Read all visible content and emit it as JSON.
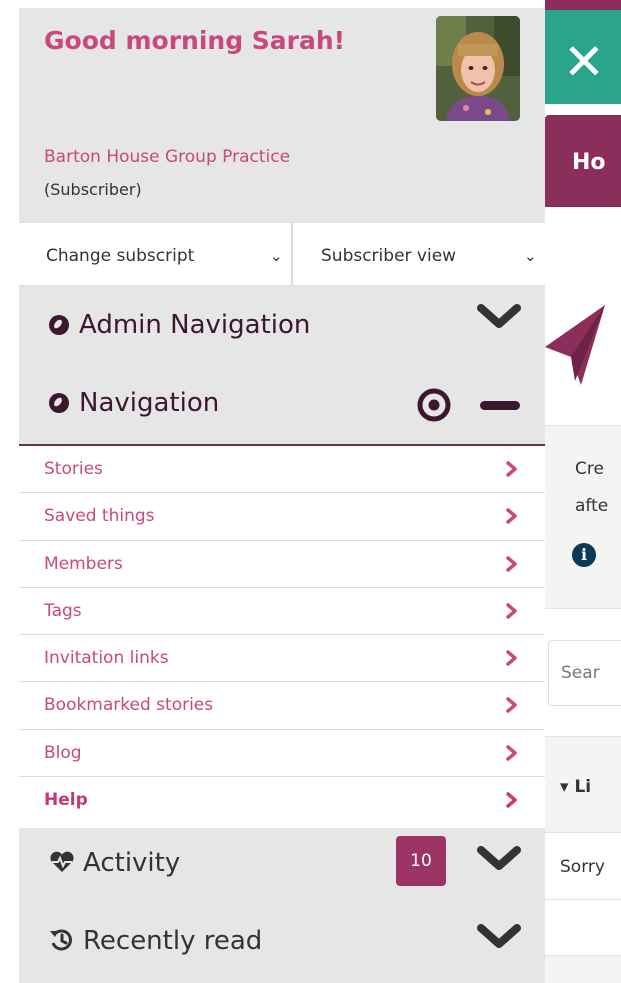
{
  "background": {
    "close_glyph": "✕",
    "home_tab_label": "Ho",
    "panel_line1": "Cre",
    "panel_line2": "afte",
    "info_glyph": "i",
    "search_placeholder": "Sear",
    "list_label": "▾ Li",
    "sorry_text": "Sorry"
  },
  "sidebar": {
    "greeting": "Good morning Sarah!",
    "practice_name": "Barton House Group Practice",
    "role": "(Subscriber)",
    "change_subscription_select": "Change subscript",
    "view_select": "Subscriber view",
    "admin_navigation": {
      "label": "Admin Navigation",
      "icon": "compass-icon",
      "state": "collapsed"
    },
    "navigation": {
      "label": "Navigation",
      "icon": "compass-icon",
      "state": "expanded",
      "items": [
        {
          "label": "Stories"
        },
        {
          "label": "Saved things"
        },
        {
          "label": "Members"
        },
        {
          "label": "Tags"
        },
        {
          "label": "Invitation links"
        },
        {
          "label": "Bookmarked stories"
        },
        {
          "label": "Blog"
        },
        {
          "label": "Help"
        }
      ]
    },
    "activity": {
      "label": "Activity",
      "icon": "heartbeat-icon",
      "count": "10",
      "state": "collapsed"
    },
    "recently_read": {
      "label": "Recently read",
      "icon": "history-icon",
      "state": "collapsed"
    }
  },
  "colors": {
    "accent_pink": "#c9487e",
    "brand_plum": "#8c2e5b",
    "dark_plum": "#3b1730",
    "teal": "#2aa58c",
    "badge": "#9c3466"
  }
}
